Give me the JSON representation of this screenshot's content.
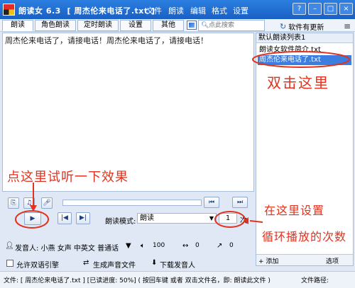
{
  "window": {
    "title": "朗读女 6.3  [ 周杰伦来电话了.txt ]",
    "menus": [
      "文件",
      "朗读",
      "编辑",
      "格式",
      "设置"
    ],
    "controls": {
      "help": "?",
      "minimize": "–",
      "maximize": "□",
      "close": "×"
    }
  },
  "toolbar": {
    "tabs": [
      "朗读",
      "角色朗读",
      "定时朗读",
      "设置",
      "其他"
    ],
    "search_placeholder": "点此搜索",
    "update_label": "软件有更新",
    "icons": [
      "picture-icon",
      "search-icon",
      "refresh-icon",
      "menu-bars-icon"
    ]
  },
  "editor": {
    "text": "周杰伦来电话了，请接电话！周杰伦来电话了，请接电话！"
  },
  "playlist": {
    "header": "默认朗读列表1",
    "items": [
      "朗读女软件简介.txt",
      "周杰伦来电话了.txt"
    ],
    "selected_index": 1,
    "footer_add": "+ 添加",
    "footer_options": "选项"
  },
  "player": {
    "play_symbol": "▶",
    "prev_symbol": "|◀",
    "next_symbol": "▶|",
    "progress": 0,
    "mode_label": "朗读模式:",
    "mode_value": "朗读",
    "times_value": "1",
    "times_unit": "次"
  },
  "speaker": {
    "label": "发音人: 小燕  女声  中英文  普通话",
    "volume_value": "100",
    "speed_value": "0",
    "pitch_value": "0"
  },
  "options": {
    "dual_engine": "允许双语引擎",
    "make_audio": "生成声音文件",
    "download_voice": "下载发音人"
  },
  "statusbar": {
    "text": "文件: [ 周杰伦来电话了.txt ]  [已读进度: 50%]  ( 按回车键 或者 双击文件名，即: 朗读此文件 )",
    "right_text": "文件路径:"
  },
  "annotations": {
    "click_here": "点这里试听一下效果",
    "double_click": "双击这里",
    "set_here": "在这里设置",
    "loop_count": "循环播放的次数"
  },
  "colors": {
    "titlebar": "#1f6fd6",
    "annotation": "#e0331f",
    "selection": "#3c7de0"
  }
}
